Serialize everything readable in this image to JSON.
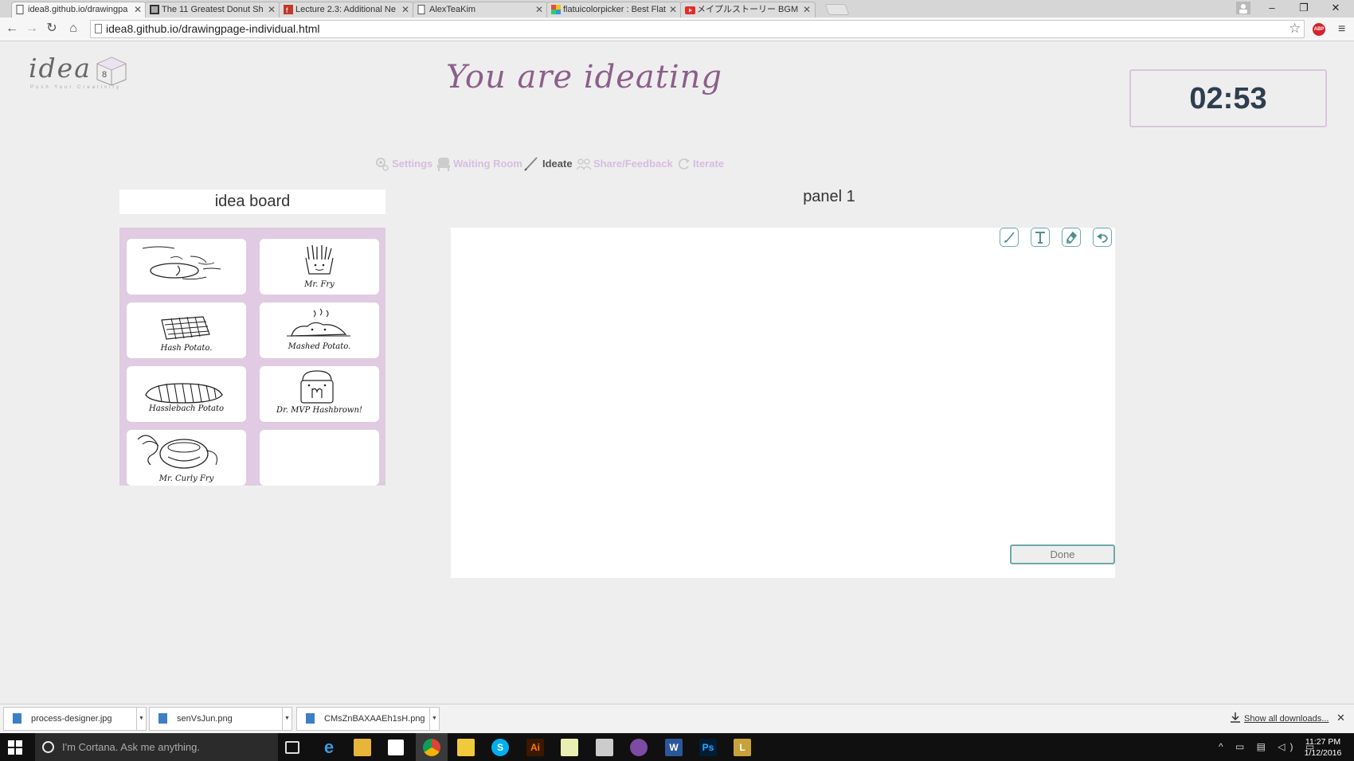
{
  "browser": {
    "tabs": [
      {
        "label": "idea8.github.io/drawingpa"
      },
      {
        "label": "The 11 Greatest Donut Sh"
      },
      {
        "label": "Lecture 2.3: Additional Ne"
      },
      {
        "label": "AlexTeaKim"
      },
      {
        "label": "flatuicolorpicker : Best Flat"
      },
      {
        "label": "メイプルストーリー BGM"
      }
    ],
    "url": "idea8.github.io/drawingpage-individual.html",
    "adblock_label": "ABP"
  },
  "header": {
    "logo_text": "idea",
    "logo_number": "8",
    "logo_tagline": "Push Your Creativity",
    "title": "You are ideating",
    "timer": "02:53"
  },
  "steps": [
    {
      "label": "Settings"
    },
    {
      "label": "Waiting Room"
    },
    {
      "label": "Ideate"
    },
    {
      "label": "Share/Feedback"
    },
    {
      "label": "Iterate"
    }
  ],
  "idea_board": {
    "title": "idea board",
    "cards": [
      {
        "caption": "Mr. Fry"
      },
      {
        "caption": "Hash Potato."
      },
      {
        "caption": "Mashed Potato."
      },
      {
        "caption": "Hasslebach Potato"
      },
      {
        "caption": "Dr. MVP Hashbrown!"
      },
      {
        "caption": "Mr. Curly Fry"
      }
    ]
  },
  "panel": {
    "title": "panel 1",
    "done_label": "Done"
  },
  "downloads": {
    "items": [
      {
        "name": "process-designer.jpg"
      },
      {
        "name": "senVsJun.png"
      },
      {
        "name": "CMsZnBAXAAEh1sH.png"
      }
    ],
    "show_all": "Show all downloads..."
  },
  "taskbar": {
    "search_placeholder": "I'm Cortana. Ask me anything.",
    "time": "11:27 PM",
    "date": "1/12/2016"
  },
  "colors": {
    "accent_purple": "#8c5f8a",
    "board_bg": "#e0cbe3",
    "tool_teal": "#6fa9a9",
    "timer_text": "#2e3e50"
  }
}
